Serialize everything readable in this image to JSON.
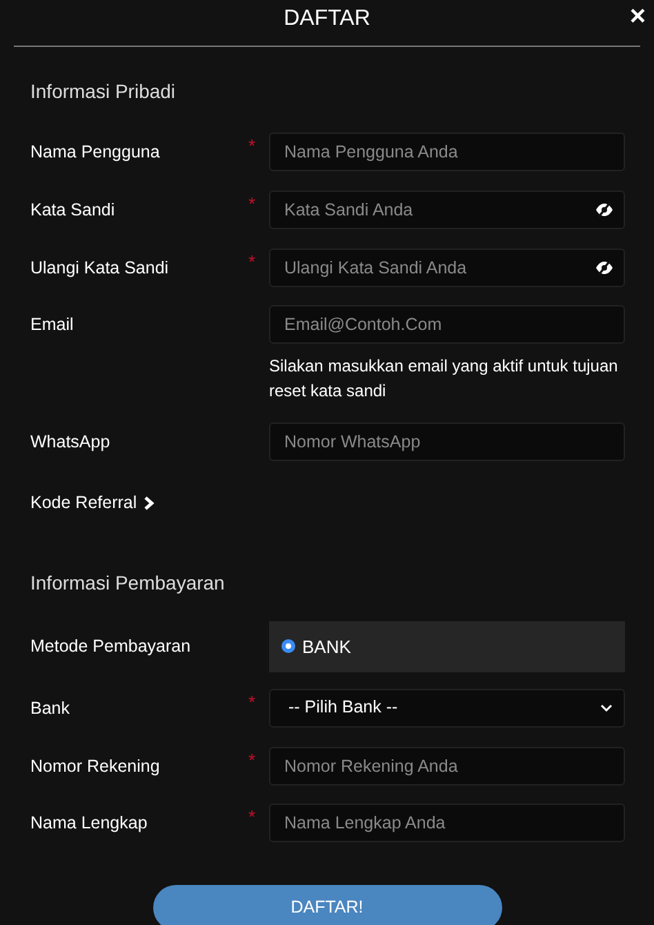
{
  "header": {
    "title": "DAFTAR",
    "close": "×"
  },
  "sections": [
    {
      "title": "Informasi Pribadi",
      "fields": [
        {
          "kind": "text",
          "label": "Nama Pengguna",
          "required_mark": "*",
          "placeholder": "Nama Pengguna Anda"
        },
        {
          "kind": "password",
          "label": "Kata Sandi",
          "required_mark": "*",
          "placeholder": "Kata Sandi Anda"
        },
        {
          "kind": "password",
          "label": "Ulangi Kata Sandi",
          "required_mark": "*",
          "placeholder": "Ulangi Kata Sandi Anda"
        },
        {
          "kind": "text",
          "label": "Email",
          "placeholder": "Email@Contoh.Com",
          "hint": "Silakan masukkan email yang aktif untuk tujuan reset kata sandi"
        },
        {
          "kind": "text",
          "label": "WhatsApp",
          "placeholder": "Nomor WhatsApp"
        },
        {
          "kind": "toggle",
          "label": "Kode Referral",
          "expanded": false
        }
      ]
    },
    {
      "title": "Informasi Pembayaran",
      "fields": [
        {
          "kind": "radio",
          "label": "Metode Pembayaran",
          "options": [
            {
              "label": "BANK",
              "selected": true
            }
          ]
        },
        {
          "kind": "select",
          "label": "Bank",
          "required_mark": "*",
          "value": "-- Pilih Bank --"
        },
        {
          "kind": "text",
          "label": "Nomor Rekening",
          "required_mark": "*",
          "placeholder": "Nomor Rekening Anda"
        },
        {
          "kind": "text",
          "label": "Nama Lengkap",
          "required_mark": "*",
          "placeholder": "Nama Lengkap Anda"
        }
      ]
    }
  ],
  "submit": "DAFTAR!"
}
